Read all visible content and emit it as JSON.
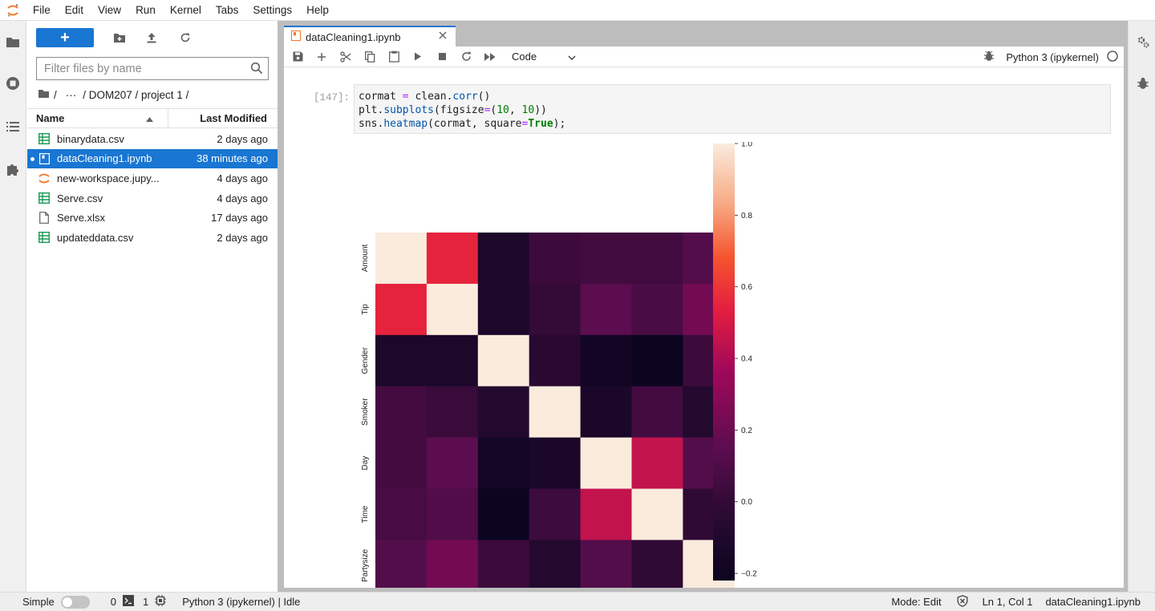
{
  "menubar": {
    "items": [
      "File",
      "Edit",
      "View",
      "Run",
      "Kernel",
      "Tabs",
      "Settings",
      "Help"
    ]
  },
  "filebrowser": {
    "new_label": "+",
    "search_placeholder": "Filter files by name",
    "breadcrumb": {
      "sep1": "/",
      "ellipsis": "···",
      "path": "/ DOM207 / project 1 /"
    },
    "columns": {
      "name": "Name",
      "modified": "Last Modified"
    },
    "files": [
      {
        "name": "binarydata.csv",
        "modified": "2 days ago",
        "icon": "spreadsheet-icon",
        "selected": false,
        "running": false
      },
      {
        "name": "dataCleaning1.ipynb",
        "modified": "38 minutes ago",
        "icon": "notebook-icon",
        "selected": true,
        "running": true
      },
      {
        "name": "new-workspace.jupyterlab-workspace",
        "display_name": "new-workspace.jupy...",
        "modified": "4 days ago",
        "icon": "jupyter-icon",
        "selected": false,
        "running": false
      },
      {
        "name": "Serve.csv",
        "modified": "4 days ago",
        "icon": "spreadsheet-icon",
        "selected": false,
        "running": false
      },
      {
        "name": "Serve.xlsx",
        "modified": "17 days ago",
        "icon": "file-icon",
        "selected": false,
        "running": false
      },
      {
        "name": "updateddata.csv",
        "modified": "2 days ago",
        "icon": "spreadsheet-icon",
        "selected": false,
        "running": false
      }
    ]
  },
  "tab": {
    "title": "dataCleaning1.ipynb"
  },
  "notebook_toolbar": {
    "cell_type": "Code",
    "kernel_name": "Python 3 (ipykernel)"
  },
  "cell": {
    "prompt": "[147]:",
    "lines": [
      "cormat = clean.corr()",
      "plt.subplots(figsize=(10, 10))",
      "sns.heatmap(cormat, square=True);"
    ]
  },
  "chart_data": {
    "type": "heatmap",
    "title": "",
    "xlabel": "",
    "ylabel": "",
    "labels": [
      "Amount",
      "Tip",
      "Gender",
      "Smoker",
      "Day",
      "Time",
      "Partysize"
    ],
    "matrix": [
      [
        1.0,
        0.55,
        -0.12,
        0.03,
        0.05,
        0.05,
        0.12
      ],
      [
        0.55,
        1.0,
        -0.12,
        0.0,
        0.15,
        0.08,
        0.22
      ],
      [
        -0.12,
        -0.12,
        1.0,
        -0.05,
        -0.18,
        -0.25,
        0.03
      ],
      [
        0.06,
        0.02,
        -0.08,
        1.0,
        -0.13,
        0.06,
        -0.08
      ],
      [
        0.06,
        0.15,
        -0.17,
        -0.13,
        1.0,
        0.45,
        0.12
      ],
      [
        0.07,
        0.11,
        -0.25,
        0.04,
        0.45,
        1.0,
        -0.02
      ],
      [
        0.12,
        0.22,
        0.03,
        -0.08,
        0.12,
        -0.02,
        1.0
      ]
    ],
    "colorbar": {
      "min": -0.22,
      "max": 1.0,
      "ticks": [
        -0.2,
        0.0,
        0.2,
        0.4,
        0.6,
        0.8,
        1.0
      ],
      "tick_labels": [
        "−0.2",
        "0.0",
        "0.2",
        "0.4",
        "0.6",
        "0.8",
        "1.0"
      ]
    },
    "colormap": "rocket",
    "colors": {
      "low": "#0b0520",
      "mid_low": "#5b0d4f",
      "mid": "#b0095a",
      "mid_high": "#f2312b",
      "high": "#faebdd"
    }
  },
  "statusbar": {
    "mode_label": "Simple",
    "terminals_count": "0",
    "kernels_count": "1",
    "kernel_status": "Python 3 (ipykernel) | Idle",
    "edit_mode": "Mode: Edit",
    "cursor": "Ln 1, Col 1",
    "filename": "dataCleaning1.ipynb"
  },
  "colors": {
    "accent": "#1976d2",
    "jupyter_orange": "#f37726",
    "csv_green": "#1b9a59"
  }
}
